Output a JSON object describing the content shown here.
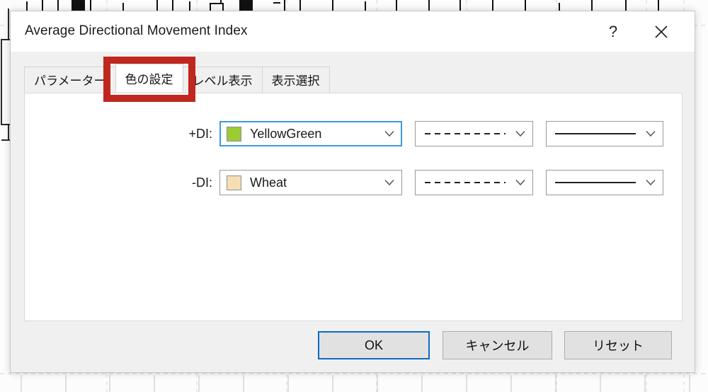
{
  "window": {
    "title": "Average Directional Movement Index",
    "help_label": "?",
    "close_icon": "close-icon",
    "help_icon": "help-icon"
  },
  "tabs": [
    {
      "label": "パラメーター",
      "selected": false
    },
    {
      "label": "色の設定",
      "selected": true
    },
    {
      "label": "レベル表示",
      "selected": false
    },
    {
      "label": "表示選択",
      "selected": false
    }
  ],
  "color_settings": {
    "rows": [
      {
        "label": "+DI:",
        "color_name": "YellowGreen",
        "color_hex": "#9ACD32",
        "line_style": "dashed",
        "line_width": "solid",
        "focused": true
      },
      {
        "label": "-DI:",
        "color_name": "Wheat",
        "color_hex": "#F5DEB3",
        "line_style": "dashed",
        "line_width": "solid",
        "focused": false
      }
    ]
  },
  "footer": {
    "ok_label": "OK",
    "cancel_label": "キャンセル",
    "reset_label": "リセット"
  },
  "annotation": {
    "shape": "rectangle-highlight",
    "color_hex": "#C0271E",
    "targets_tab": "色の設定"
  },
  "background": {
    "description": "price candlestick chart behind dialog",
    "grid_color": "#d9d9d9",
    "candle_color": "#111111"
  }
}
